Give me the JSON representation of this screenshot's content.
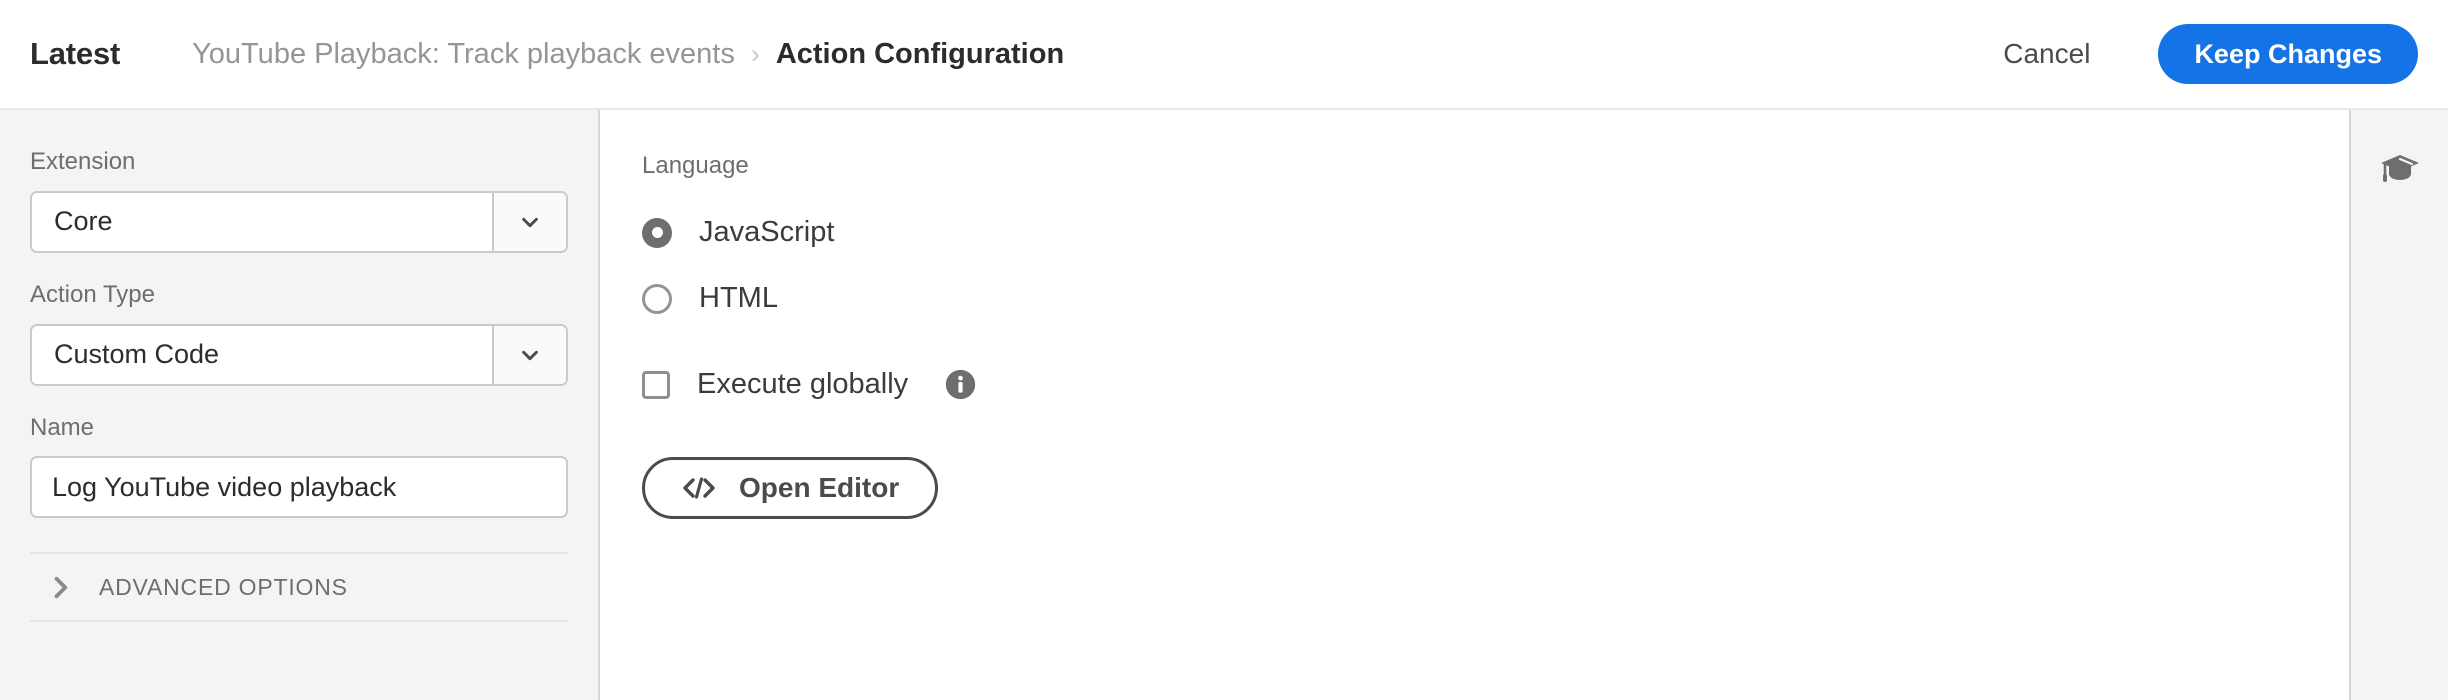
{
  "header": {
    "environment_label": "Latest",
    "breadcrumb": {
      "parent": "YouTube Playback: Track playback events",
      "separator": "›",
      "current": "Action Configuration"
    },
    "cancel_label": "Cancel",
    "keep_changes_label": "Keep Changes",
    "accent_color": "#1473E6"
  },
  "left_panel": {
    "extension": {
      "label": "Extension",
      "value": "Core",
      "chevron_icon": "chevron-down-icon"
    },
    "action_type": {
      "label": "Action Type",
      "value": "Custom Code",
      "chevron_icon": "chevron-down-icon"
    },
    "name": {
      "label": "Name",
      "value": "Log YouTube video playback",
      "placeholder": "Name"
    },
    "advanced_options": {
      "label": "ADVANCED OPTIONS",
      "chevron_icon": "chevron-right-icon",
      "expanded": false
    }
  },
  "main": {
    "language": {
      "label": "Language",
      "options": [
        {
          "label": "JavaScript",
          "selected": true
        },
        {
          "label": "HTML",
          "selected": false
        }
      ]
    },
    "execute_globally": {
      "label": "Execute globally",
      "checked": false,
      "info_icon": "info-icon"
    },
    "open_editor": {
      "label": "Open Editor",
      "icon": "code-icon"
    }
  },
  "right_rail": {
    "learning_icon": "graduation-cap-icon"
  }
}
